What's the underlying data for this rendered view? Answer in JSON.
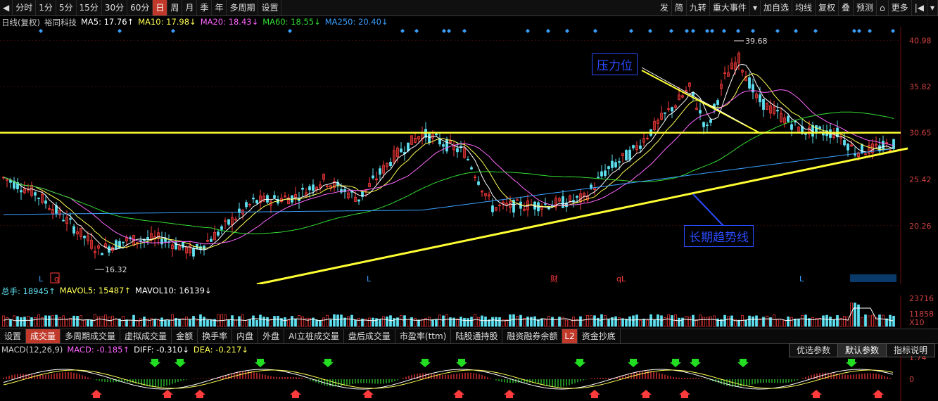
{
  "toolbar": {
    "left": [
      "分时",
      "1分",
      "5分",
      "15分",
      "30分",
      "60分",
      "日",
      "周",
      "月",
      "季",
      "年",
      "多周期",
      "设置"
    ],
    "active": "日",
    "right": [
      "发",
      "简",
      "九转",
      "重大事件",
      "加自选",
      "均线",
      "复权",
      "叠",
      "预测",
      "更多"
    ]
  },
  "legend": {
    "name": "日线(复权)",
    "stock": "裕同科技",
    "ma5": "MA5: 17.76↑",
    "ma10": "MA10: 17.98↓",
    "ma20": "MA20: 18.43↓",
    "ma60": "MA60: 18.55↓",
    "ma250": "MA250: 20.40↓"
  },
  "colors": {
    "up": "#ff3b3b",
    "down": "#5ee0f0",
    "ma5": "#ffffff",
    "ma10": "#ffff55",
    "ma20": "#ff66ff",
    "ma60": "#33dd33",
    "ma250": "#3aa0ff",
    "trendline": "#ffff33",
    "annotation": "#2a4cff"
  },
  "chart_data": {
    "type": "candlestick",
    "price_axis_ticks": [
      "40.98",
      "35.82",
      "30.65",
      "25.42",
      "20.26"
    ],
    "price_range": [
      14.5,
      42.5
    ],
    "high_label": "39.68",
    "low_label": "16.32",
    "resistance_level": 30.65,
    "annotations": [
      "压力位",
      "长期趋势线"
    ],
    "event_markers": [
      "L",
      "q",
      "L",
      "财",
      "qL",
      "L"
    ],
    "volume_axis_ticks": [
      "23716",
      "11858",
      "X10"
    ],
    "macd_axis_ticks": [
      "1.74",
      "0"
    ]
  },
  "volume_legend": {
    "total": "总手: 18945↑",
    "mavol5": "MAVOL5: 15487↑",
    "mavol10": "MAVOL10: 16139↓"
  },
  "tabs": [
    "设置",
    "成交量",
    "多周期成交量",
    "虚拟成交量",
    "金额",
    "换手率",
    "内盘",
    "外盘",
    "AI立桩成交量",
    "盘后成交量",
    "市盈率(ttm)",
    "陆股通持股",
    "融资融券余额",
    "L2",
    "资金抄底"
  ],
  "active_tab": "成交量",
  "macd_legend": {
    "name": "MACD(12,26,9)",
    "macd": "MACD: -0.185↑",
    "diff": "DIFF: -0.310↓",
    "dea": "DEA: -0.217↓"
  },
  "macd_buttons": [
    "优选参数",
    "默认参数",
    "指标说明"
  ]
}
